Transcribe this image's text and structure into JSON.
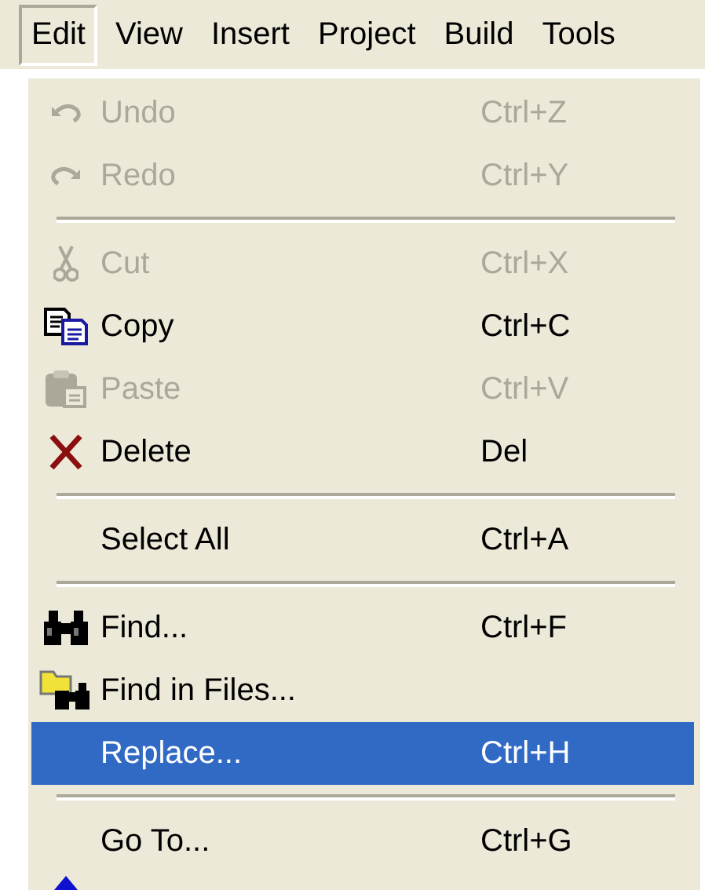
{
  "menu_bar": [
    {
      "label": "Edit",
      "selected": true
    },
    {
      "label": "View",
      "selected": false
    },
    {
      "label": "Insert",
      "selected": false
    },
    {
      "label": "Project",
      "selected": false
    },
    {
      "label": "Build",
      "selected": false
    },
    {
      "label": "Tools",
      "selected": false
    }
  ],
  "menu": {
    "items": [
      {
        "kind": "item",
        "label": "Undo",
        "shortcut": "Ctrl+Z",
        "disabled": true,
        "selected": false
      },
      {
        "kind": "item",
        "label": "Redo",
        "shortcut": "Ctrl+Y",
        "disabled": true,
        "selected": false
      },
      {
        "kind": "separator"
      },
      {
        "kind": "item",
        "label": "Cut",
        "shortcut": "Ctrl+X",
        "disabled": true,
        "selected": false
      },
      {
        "kind": "item",
        "label": "Copy",
        "shortcut": "Ctrl+C",
        "disabled": false,
        "selected": false
      },
      {
        "kind": "item",
        "label": "Paste",
        "shortcut": "Ctrl+V",
        "disabled": true,
        "selected": false
      },
      {
        "kind": "item",
        "label": "Delete",
        "shortcut": "Del",
        "disabled": false,
        "selected": false
      },
      {
        "kind": "separator"
      },
      {
        "kind": "item",
        "label": "Select All",
        "shortcut": "Ctrl+A",
        "disabled": false,
        "selected": false
      },
      {
        "kind": "separator"
      },
      {
        "kind": "item",
        "label": "Find...",
        "shortcut": "Ctrl+F",
        "disabled": false,
        "selected": false
      },
      {
        "kind": "item",
        "label": "Find in Files...",
        "disabled": false,
        "selected": false
      },
      {
        "kind": "item",
        "label": "Replace...",
        "shortcut": "Ctrl+H",
        "disabled": false,
        "selected": true
      },
      {
        "kind": "separator"
      },
      {
        "kind": "item",
        "label": "Go To...",
        "shortcut": "Ctrl+G",
        "disabled": false,
        "selected": false
      }
    ]
  }
}
